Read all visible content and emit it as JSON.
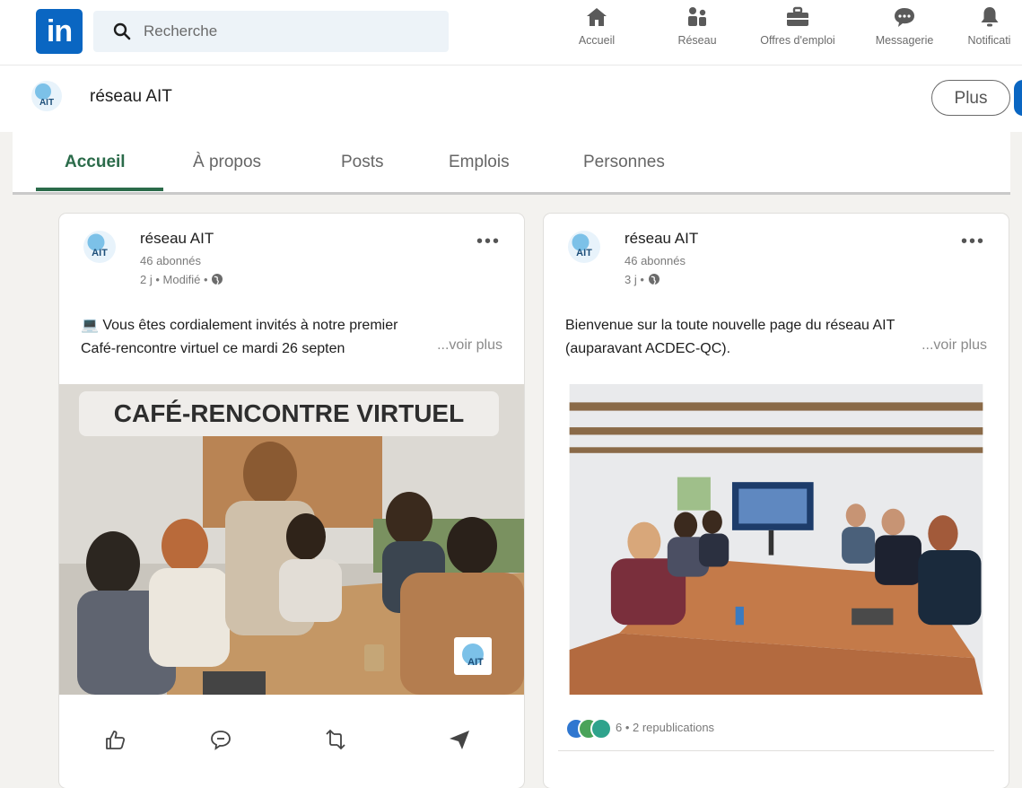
{
  "nav": {
    "logo_text": "in",
    "search_placeholder": "Recherche",
    "items": [
      {
        "label": "Accueil",
        "icon": "home-icon"
      },
      {
        "label": "Réseau",
        "icon": "network-icon"
      },
      {
        "label": "Offres d'emploi",
        "icon": "briefcase-icon"
      },
      {
        "label": "Messagerie",
        "icon": "messaging-icon"
      },
      {
        "label": "Notificati",
        "icon": "bell-icon"
      }
    ]
  },
  "page": {
    "title": "réseau AIT",
    "plus_label": "Plus"
  },
  "tabs": [
    "Accueil",
    "À propos",
    "Posts",
    "Emplois",
    "Personnes"
  ],
  "posts": [
    {
      "author": "réseau AIT",
      "followers": "46 abonnés",
      "meta": "2 j • Modifié •",
      "text_line1": "💻 Vous êtes cordialement invités à notre premier",
      "text_line2": "Café-rencontre virtuel ce mardi 26 septen",
      "see_more": "...voir plus",
      "image_banner": "CAFÉ-RENCONTRE VIRTUEL",
      "image_logo": "AIT"
    },
    {
      "author": "réseau AIT",
      "followers": "46 abonnés",
      "meta": "3 j •",
      "text_line1": "Bienvenue sur la toute nouvelle page du réseau AIT",
      "text_line2": "(auparavant ACDEC-QC).",
      "see_more": "...voir plus",
      "reactions": "6 • 2 republications"
    }
  ],
  "colors": {
    "brand_blue": "#0a66c2",
    "active_tab": "#2b6b4a",
    "page_bg": "#f3f2ef"
  }
}
